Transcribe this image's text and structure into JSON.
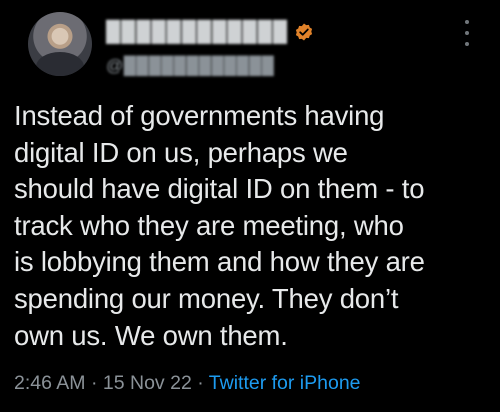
{
  "header": {
    "display_name": "████████████",
    "handle": "@████████████",
    "verified_color": "#e0822a",
    "verified_icon": "verified-badge-icon",
    "more_icon": "more-options-icon"
  },
  "tweet": {
    "lines": [
      "Instead of governments having",
      "digital ID on us, perhaps we",
      "should have digital ID on them - to",
      "track who they are meeting, who",
      "is lobbying them and how they are",
      "spending our money. They don’t",
      "own us. We own them."
    ]
  },
  "meta": {
    "time": "2:46 AM",
    "sep1": " · ",
    "date": "15 Nov 22",
    "sep2": " · ",
    "source": "Twitter for iPhone",
    "link_color": "#1d9bf0"
  }
}
